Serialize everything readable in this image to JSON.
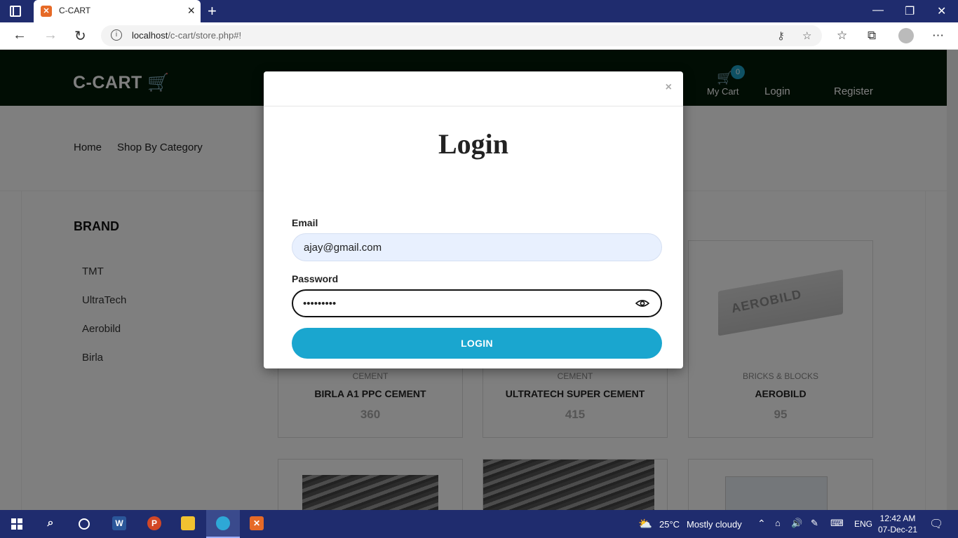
{
  "browser": {
    "tab_title": "C-CART",
    "tab_favicon": "xampp-icon",
    "url_host": "localhost",
    "url_path": "/c-cart/store.php#!"
  },
  "site": {
    "logo": "C-CART",
    "cart_count": "0",
    "cart_label": "My Cart",
    "login_link": "Login",
    "register_link": "Register",
    "nav": [
      "Home",
      "Shop By Category"
    ],
    "brand_title": "BRAND",
    "brands": [
      "TMT",
      "UltraTech",
      "Aerobild",
      "Birla"
    ],
    "products": [
      {
        "category": "CEMENT",
        "name": "BIRLA A1 PPC CEMENT",
        "price": "360"
      },
      {
        "category": "CEMENT",
        "name": "ULTRATECH SUPER CEMENT",
        "price": "415"
      },
      {
        "category": "BRICKS & BLOCKS",
        "name": "AEROBILD",
        "price": "95"
      }
    ],
    "aerobild_image_text": "AEROBILD"
  },
  "modal": {
    "close": "×",
    "title": "Login",
    "email_label": "Email",
    "email_value": "ajay@gmail.com",
    "password_label": "Password",
    "password_value": "•••••••••",
    "login_button": "LOGIN"
  },
  "taskbar": {
    "weather_temp": "25°C",
    "weather_text": "Mostly cloudy",
    "language": "ENG",
    "time": "12:42 AM",
    "date": "07-Dec-21"
  },
  "colors": {
    "header_bg": "#021a08",
    "accent": "#1aa6cf",
    "taskbar": "#1f2c6e"
  }
}
